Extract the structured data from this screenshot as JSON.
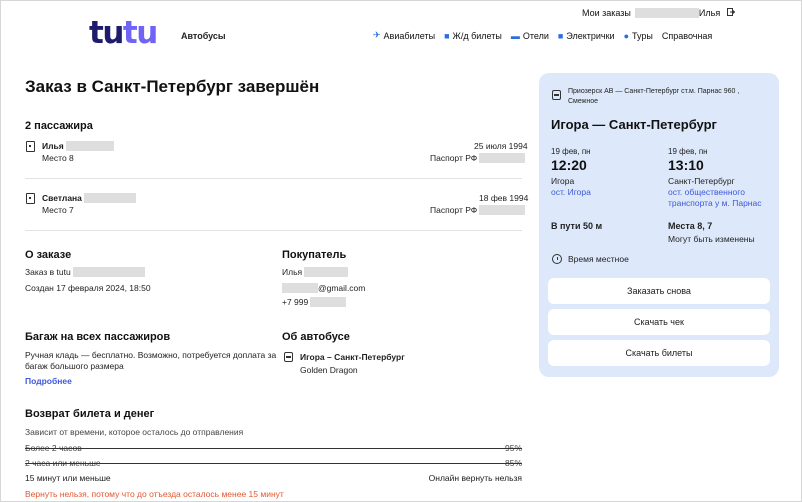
{
  "header": {
    "logo": {
      "part1": "tu",
      "part2": "tu",
      "subtitle": "Автобусы"
    },
    "account": {
      "orders": "Мои заказы",
      "name": "Илья",
      "logout_icon": "logout-icon"
    },
    "nav": [
      {
        "icon": "✈",
        "icon_name": "plane-icon",
        "label": "Авиабилеты"
      },
      {
        "icon": "■",
        "icon_name": "train-icon",
        "label": "Ж/д билеты"
      },
      {
        "icon": "▬",
        "icon_name": "hotel-icon",
        "label": "Отели"
      },
      {
        "icon": "■",
        "icon_name": "suburban-train-icon",
        "label": "Электрички"
      },
      {
        "icon": "●",
        "icon_name": "tours-icon",
        "label": "Туры"
      },
      {
        "icon": "",
        "icon_name": "",
        "label": "Справочная"
      }
    ]
  },
  "main": {
    "title": "Заказ в Санкт-Петербург завершён",
    "passengers_heading": "2 пассажира",
    "passengers": [
      {
        "name": "Илья",
        "seat": "Место 8",
        "birth": "25 июля 1994",
        "doc": "Паспорт РФ"
      },
      {
        "name": "Светлана",
        "seat": "Место 7",
        "birth": "18 фев 1994",
        "doc": "Паспорт РФ"
      }
    ],
    "order": {
      "heading": "О заказе",
      "in_tutu": "Заказ в tutu",
      "created": "Создан 17 февраля 2024, 18:50"
    },
    "buyer": {
      "heading": "Покупатель",
      "name": "Илья",
      "email": "@gmail.com",
      "phone": "+7 999"
    },
    "baggage": {
      "heading": "Багаж на всех пассажиров",
      "line1": "Ручная кладь — бесплатно. Возможно, потребуется доплата за",
      "line2": "багаж большого размера",
      "more": "Подробнее"
    },
    "bus": {
      "heading": "Об автобусе",
      "route": "Игора – Санкт-Петербург",
      "model": "Golden Dragon"
    },
    "refund": {
      "heading": "Возврат билета и денег",
      "sub": "Зависит от времени, которое осталось до отправления",
      "rows": [
        {
          "label": "Более 2 часов",
          "value": "95%"
        },
        {
          "label": "2 часа или меньше",
          "value": "85%"
        },
        {
          "label": "15 минут или меньше",
          "value": "Онлайн вернуть нельзя"
        }
      ],
      "warning": "Вернуть нельзя, потому что до отъезда осталось менее 15 минут"
    }
  },
  "card": {
    "route_line1": "Приозерск АВ — Санкт-Петербург ст.м. Парнас 960 ,",
    "route_line2": "Смежное",
    "title": "Игора — Санкт-Петербург",
    "dep": {
      "date": "19 фев, пн",
      "time": "12:20",
      "city": "Игора",
      "stop": "ост. Игора"
    },
    "arr": {
      "date": "19 фев, пн",
      "time": "13:10",
      "city": "Санкт-Петербург",
      "stop1": "ост. общественного",
      "stop2": "транспорта у м. Парнас"
    },
    "duration": "В пути 50 м",
    "seats": "Места 8, 7",
    "seats_note": "Могут быть изменены",
    "local_time": "Время местное",
    "buttons": {
      "reorder": "Заказать снова",
      "receipt": "Скачать чек",
      "tickets": "Скачать билеты"
    }
  }
}
